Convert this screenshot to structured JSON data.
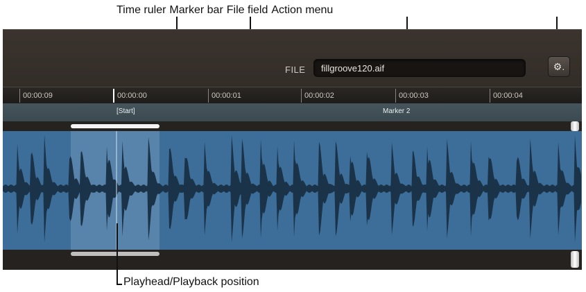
{
  "callouts": {
    "time_ruler": "Time ruler",
    "marker_bar": "Marker bar",
    "file_field": "File field",
    "action_menu": "Action menu",
    "playhead": "Playhead/Playback position"
  },
  "file": {
    "label": "FILE",
    "name": "fillgroove120.aif"
  },
  "action_button": {
    "icon": "gear-icon",
    "glyph": "⚙."
  },
  "ruler": {
    "ticks": [
      "00:00:09",
      "00:00:00",
      "00:00:01",
      "00:00:02",
      "00:00:03",
      "00:00:04"
    ]
  },
  "markers": [
    "[Start]",
    "Marker 2"
  ],
  "colors": {
    "waveform_bg": "#3c6e99",
    "waveform_fill": "#1b3349",
    "selection": "#7aa0c0"
  }
}
